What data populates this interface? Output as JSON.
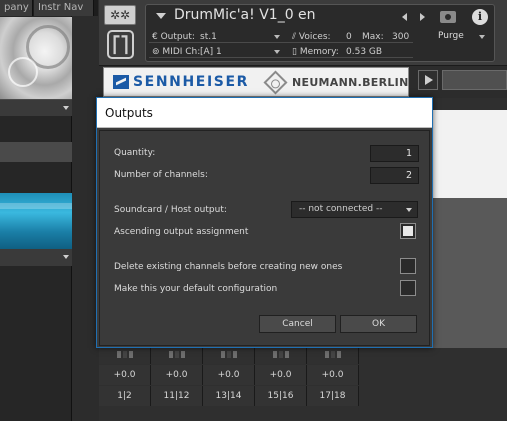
{
  "browser": {
    "tabs": [
      "pany",
      "Instr Nav"
    ]
  },
  "instrument": {
    "title": "DrumMic'a! V1_0 en",
    "tools_icon": "gears-icon",
    "output_label": "Output:",
    "output_value": "st.1",
    "voices_label": "Voices:",
    "voices_value": "0",
    "max_label": "Max:",
    "max_value": "300",
    "purge_label": "Purge",
    "midi_label": "MIDI Ch:",
    "midi_value": "[A]  1",
    "memory_label": "Memory:",
    "memory_value": "0.53 GB",
    "info_label": "i"
  },
  "banner": {
    "sennheiser": "SENNHEISER",
    "neumann": "NEUMANN.BERLIN"
  },
  "channels": {
    "pans": [
      "+0.0",
      "+0.0",
      "+0.0",
      "+0.0",
      "+0.0"
    ],
    "numbers": [
      "1|2",
      "11|12",
      "13|14",
      "15|16",
      "17|18"
    ]
  },
  "dialog": {
    "title": "Outputs",
    "quantity_label": "Quantity:",
    "quantity_value": "1",
    "channels_label": "Number of channels:",
    "channels_value": "2",
    "soundcard_label": "Soundcard / Host output:",
    "soundcard_value": "-- not connected --",
    "ascending_label": "Ascending output assignment",
    "ascending_checked": true,
    "delete_label": "Delete existing channels before creating new ones",
    "delete_checked": false,
    "default_label": "Make this your default configuration",
    "default_checked": false,
    "cancel_label": "Cancel",
    "ok_label": "OK"
  },
  "colors": {
    "dialog_border": "#1f6fb2",
    "sennheiser_blue": "#1b5aa6",
    "dialog_bg": "#3b3b3b"
  }
}
